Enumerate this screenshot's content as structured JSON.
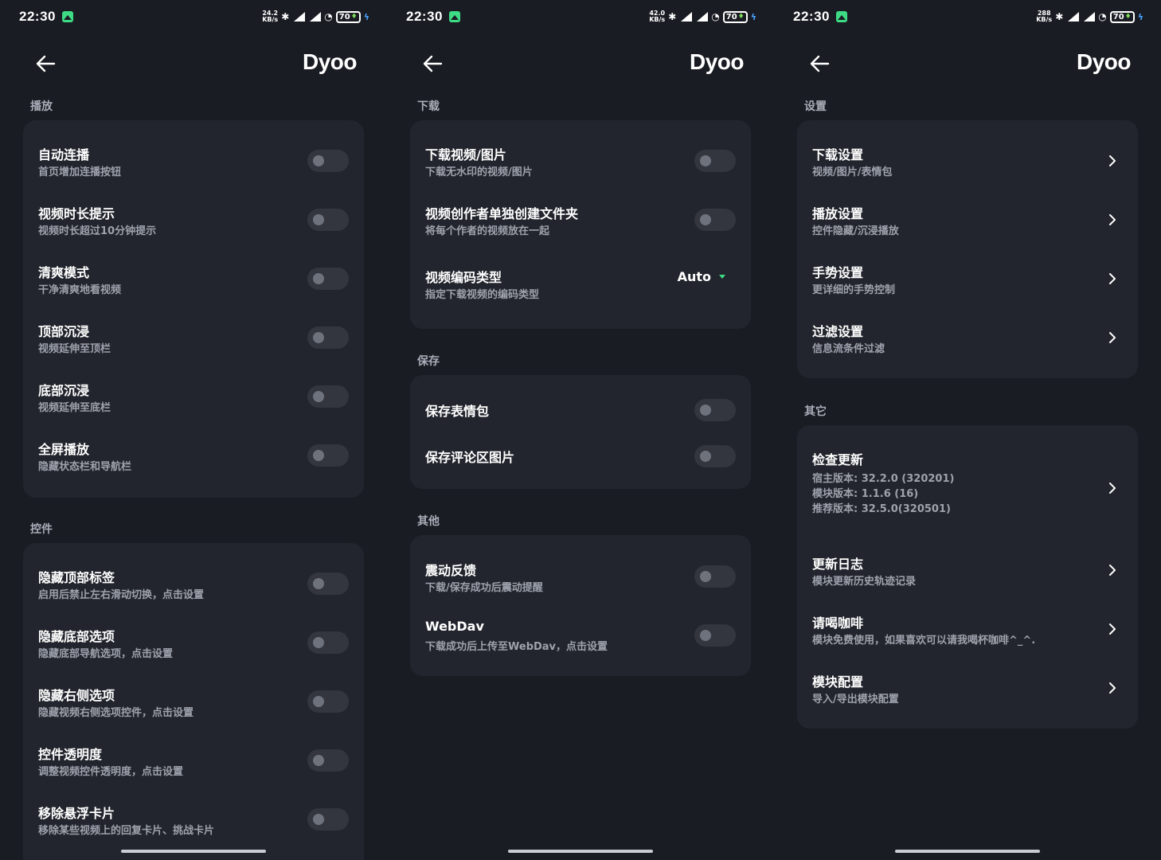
{
  "status": {
    "time": "22:30",
    "battery": "70",
    "speeds": [
      "24.2 KB/s",
      "42.0 KB/s",
      "288 KB/s"
    ]
  },
  "app": {
    "title": "Dyoo"
  },
  "panel1": {
    "sections": [
      {
        "title": "播放",
        "items": [
          {
            "title": "自动连播",
            "subtitle": "首页增加连播按钮"
          },
          {
            "title": "视频时长提示",
            "subtitle": "视频时长超过10分钟提示"
          },
          {
            "title": "清爽模式",
            "subtitle": "干净清爽地看视频"
          },
          {
            "title": "顶部沉浸",
            "subtitle": "视频延伸至顶栏"
          },
          {
            "title": "底部沉浸",
            "subtitle": "视频延伸至底栏"
          },
          {
            "title": "全屏播放",
            "subtitle": "隐藏状态栏和导航栏"
          }
        ]
      },
      {
        "title": "控件",
        "items": [
          {
            "title": "隐藏顶部标签",
            "subtitle": "启用后禁止左右滑动切换，点击设置"
          },
          {
            "title": "隐藏底部选项",
            "subtitle": "隐藏底部导航选项，点击设置"
          },
          {
            "title": "隐藏右侧选项",
            "subtitle": "隐藏视频右侧选项控件，点击设置"
          },
          {
            "title": "控件透明度",
            "subtitle": "调整视频控件透明度，点击设置"
          },
          {
            "title": "移除悬浮卡片",
            "subtitle": "移除某些视频上的回复卡片、挑战卡片"
          }
        ]
      }
    ]
  },
  "panel2": {
    "sections": [
      {
        "title": "下载",
        "items": [
          {
            "title": "下载视频/图片",
            "subtitle": "下载无水印的视频/图片"
          },
          {
            "title": "视频创作者单独创建文件夹",
            "subtitle": "将每个作者的视频放在一起"
          },
          {
            "title": "视频编码类型",
            "subtitle": "指定下载视频的编码类型",
            "value": "Auto"
          }
        ]
      },
      {
        "title": "保存",
        "items": [
          {
            "title": "保存表情包"
          },
          {
            "title": "保存评论区图片"
          }
        ]
      },
      {
        "title": "其他",
        "items": [
          {
            "title": "震动反馈",
            "subtitle": "下载/保存成功后震动提醒"
          },
          {
            "title": "WebDav",
            "subtitle": "下载成功后上传至WebDav，点击设置"
          }
        ]
      }
    ]
  },
  "panel3": {
    "sections": [
      {
        "title": "设置",
        "items": [
          {
            "title": "下载设置",
            "subtitle": "视频/图片/表情包"
          },
          {
            "title": "播放设置",
            "subtitle": "控件隐藏/沉浸播放"
          },
          {
            "title": "手势设置",
            "subtitle": "更详细的手势控制"
          },
          {
            "title": "过滤设置",
            "subtitle": "信息流条件过滤"
          }
        ]
      },
      {
        "title": "其它",
        "update": {
          "title": "检查更新",
          "lines": [
            "宿主版本: 32.2.0 (320201)",
            "模块版本: 1.1.6 (16)",
            "推荐版本: 32.5.0(320501)"
          ]
        },
        "items": [
          {
            "title": "更新日志",
            "subtitle": "模块更新历史轨迹记录"
          },
          {
            "title": "请喝咖啡",
            "subtitle": "模块免费使用，如果喜欢可以请我喝杯咖啡^_^."
          },
          {
            "title": "模块配置",
            "subtitle": "导入/导出模块配置"
          }
        ]
      }
    ]
  }
}
